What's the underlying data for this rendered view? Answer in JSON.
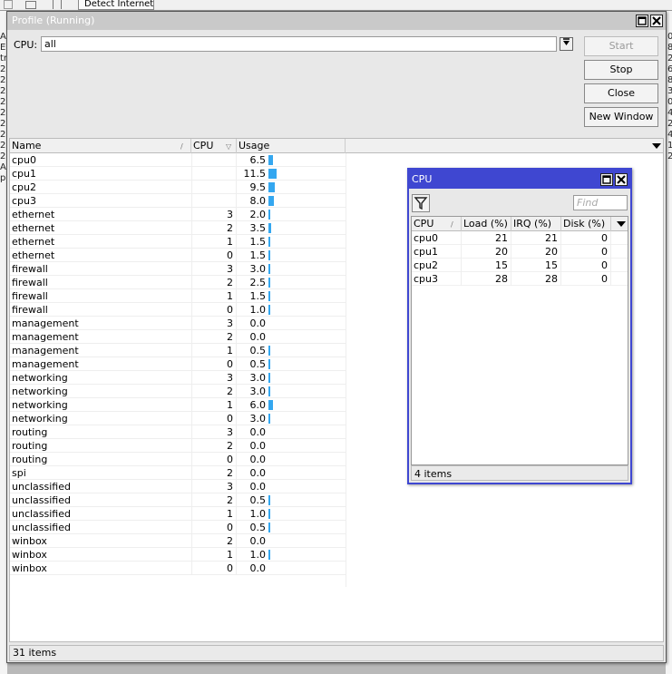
{
  "background": {
    "tab_label": "Detect Internet",
    "left_letters": [
      "A",
      "E",
      "tr",
      "2",
      "2",
      "2",
      "2",
      "2",
      "2",
      "2",
      "2",
      "2",
      "A",
      "p"
    ],
    "right_letters": [
      "0",
      "8",
      "2",
      "6",
      "8",
      "3",
      "0",
      "4",
      "2",
      "4",
      "1",
      "2"
    ]
  },
  "profile_window": {
    "title": "Profile (Running)",
    "maximize_icon": "restore-icon",
    "close_icon": "close-icon",
    "cpu_label": "CPU:",
    "cpu_value": "all",
    "buttons": {
      "start": "Start",
      "stop": "Stop",
      "close": "Close",
      "new_window": "New Window"
    },
    "columns": {
      "name": "Name",
      "cpu": "CPU",
      "usage": "Usage"
    },
    "rows": [
      {
        "name": "cpu0",
        "cpu": "",
        "usage": "6.5",
        "usage_value": 6.5
      },
      {
        "name": "cpu1",
        "cpu": "",
        "usage": "11.5",
        "usage_value": 11.5
      },
      {
        "name": "cpu2",
        "cpu": "",
        "usage": "9.5",
        "usage_value": 9.5
      },
      {
        "name": "cpu3",
        "cpu": "",
        "usage": "8.0",
        "usage_value": 8.0
      },
      {
        "name": "ethernet",
        "cpu": "3",
        "usage": "2.0",
        "usage_value": 2.0
      },
      {
        "name": "ethernet",
        "cpu": "2",
        "usage": "3.5",
        "usage_value": 3.5
      },
      {
        "name": "ethernet",
        "cpu": "1",
        "usage": "1.5",
        "usage_value": 1.5
      },
      {
        "name": "ethernet",
        "cpu": "0",
        "usage": "1.5",
        "usage_value": 1.5
      },
      {
        "name": "firewall",
        "cpu": "3",
        "usage": "3.0",
        "usage_value": 3.0
      },
      {
        "name": "firewall",
        "cpu": "2",
        "usage": "2.5",
        "usage_value": 2.5
      },
      {
        "name": "firewall",
        "cpu": "1",
        "usage": "1.5",
        "usage_value": 1.5
      },
      {
        "name": "firewall",
        "cpu": "0",
        "usage": "1.0",
        "usage_value": 1.0
      },
      {
        "name": "management",
        "cpu": "3",
        "usage": "0.0",
        "usage_value": 0
      },
      {
        "name": "management",
        "cpu": "2",
        "usage": "0.0",
        "usage_value": 0
      },
      {
        "name": "management",
        "cpu": "1",
        "usage": "0.5",
        "usage_value": 0.5
      },
      {
        "name": "management",
        "cpu": "0",
        "usage": "0.5",
        "usage_value": 0.5
      },
      {
        "name": "networking",
        "cpu": "3",
        "usage": "3.0",
        "usage_value": 3.0
      },
      {
        "name": "networking",
        "cpu": "2",
        "usage": "3.0",
        "usage_value": 3.0
      },
      {
        "name": "networking",
        "cpu": "1",
        "usage": "6.0",
        "usage_value": 6.0
      },
      {
        "name": "networking",
        "cpu": "0",
        "usage": "3.0",
        "usage_value": 3.0
      },
      {
        "name": "routing",
        "cpu": "3",
        "usage": "0.0",
        "usage_value": 0
      },
      {
        "name": "routing",
        "cpu": "2",
        "usage": "0.0",
        "usage_value": 0
      },
      {
        "name": "routing",
        "cpu": "0",
        "usage": "0.0",
        "usage_value": 0
      },
      {
        "name": "spi",
        "cpu": "2",
        "usage": "0.0",
        "usage_value": 0
      },
      {
        "name": "unclassified",
        "cpu": "3",
        "usage": "0.0",
        "usage_value": 0
      },
      {
        "name": "unclassified",
        "cpu": "2",
        "usage": "0.5",
        "usage_value": 0.5
      },
      {
        "name": "unclassified",
        "cpu": "1",
        "usage": "1.0",
        "usage_value": 1.0
      },
      {
        "name": "unclassified",
        "cpu": "0",
        "usage": "0.5",
        "usage_value": 0.5
      },
      {
        "name": "winbox",
        "cpu": "2",
        "usage": "0.0",
        "usage_value": 0
      },
      {
        "name": "winbox",
        "cpu": "1",
        "usage": "1.0",
        "usage_value": 1.0
      },
      {
        "name": "winbox",
        "cpu": "0",
        "usage": "0.0",
        "usage_value": 0
      }
    ],
    "status": "31 items",
    "bar_color": "#34a7f0"
  },
  "cpu_window": {
    "title": "CPU",
    "find_placeholder": "Find",
    "columns": {
      "cpu": "CPU",
      "load": "Load (%)",
      "irq": "IRQ (%)",
      "disk": "Disk (%)"
    },
    "rows": [
      {
        "cpu": "cpu0",
        "load": "21",
        "irq": "21",
        "disk": "0"
      },
      {
        "cpu": "cpu1",
        "load": "20",
        "irq": "20",
        "disk": "0"
      },
      {
        "cpu": "cpu2",
        "load": "15",
        "irq": "15",
        "disk": "0"
      },
      {
        "cpu": "cpu3",
        "load": "28",
        "irq": "28",
        "disk": "0"
      }
    ],
    "status": "4 items",
    "title_color": "#3f47d1"
  }
}
